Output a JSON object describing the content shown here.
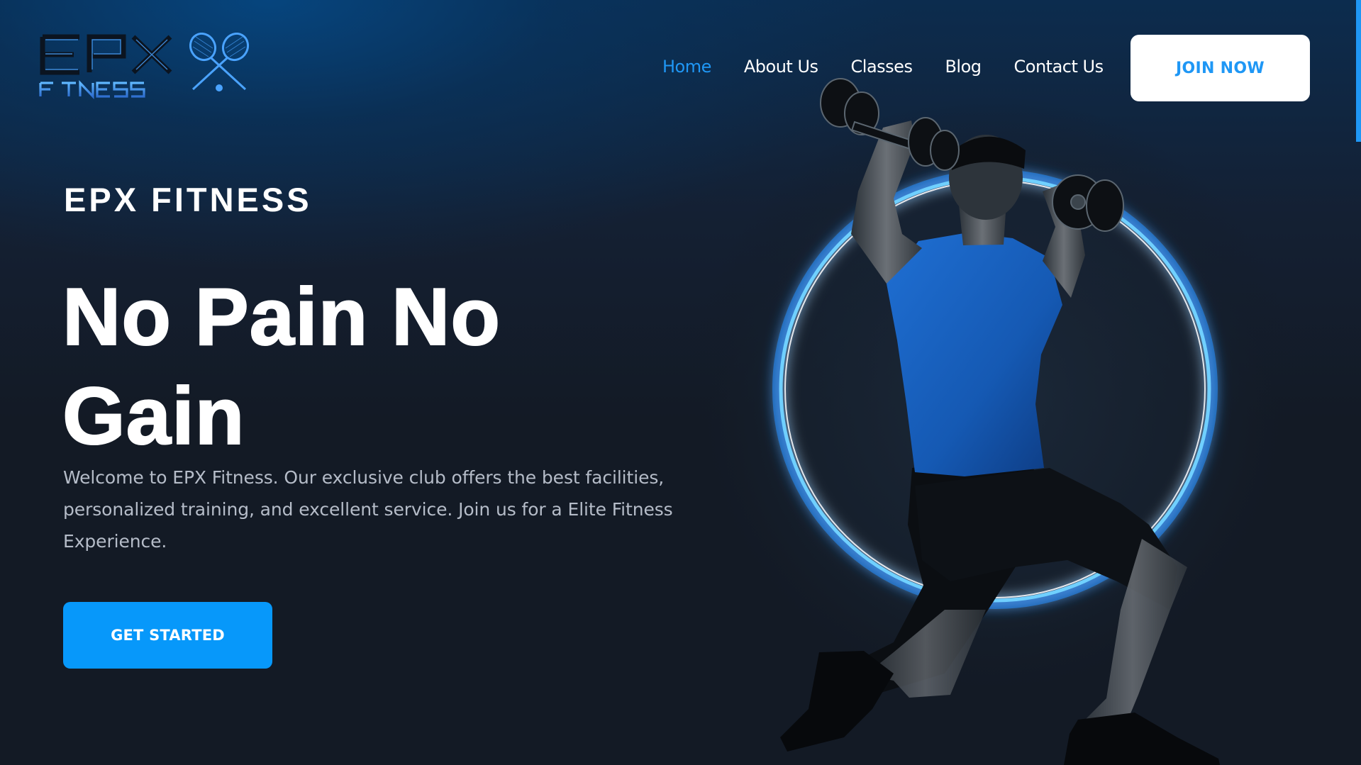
{
  "brand": {
    "logo_text_main": "EPX",
    "logo_text_sub": "FITNESS",
    "accent_color": "#1f97f5",
    "button_blue": "#0798fa",
    "background_color": "#131a25"
  },
  "nav": {
    "items": [
      {
        "label": "Home",
        "active": true
      },
      {
        "label": "About Us",
        "active": false
      },
      {
        "label": "Classes",
        "active": false
      },
      {
        "label": "Blog",
        "active": false
      },
      {
        "label": "Contact Us",
        "active": false
      }
    ],
    "join_label": "JOIN NOW"
  },
  "hero": {
    "eyebrow": "EPX FITNESS",
    "headline_line1": "No Pain No",
    "headline_line2": "Gain",
    "intro": "Welcome to EPX Fitness. Our exclusive club offers the best facilities, personalized training, and excellent service. Join us for a Elite Fitness Experience.",
    "cta_label": "GET STARTED",
    "image_subject": "athlete-lunge-with-dumbbells-glowing-ring"
  }
}
